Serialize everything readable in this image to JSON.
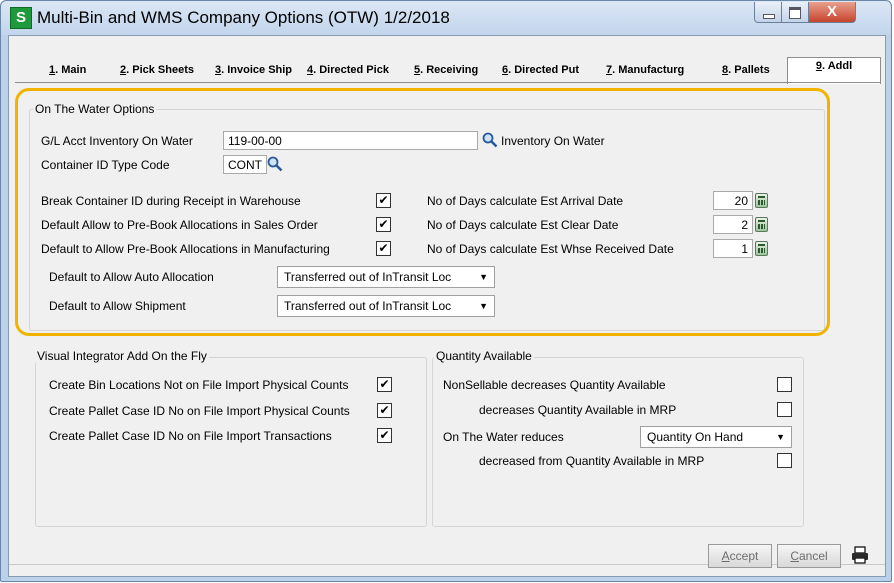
{
  "window": {
    "app_icon": "S",
    "title": "Multi-Bin and WMS Company Options (OTW) 1/2/2018",
    "close_glyph": "X"
  },
  "tabs": [
    {
      "key": "1",
      "label": ". Main"
    },
    {
      "key": "2",
      "label": ". Pick Sheets"
    },
    {
      "key": "3",
      "label": ". Invoice Ship"
    },
    {
      "key": "4",
      "label": ". Directed Pick"
    },
    {
      "key": "5",
      "label": ". Receiving"
    },
    {
      "key": "6",
      "label": ". Directed Put"
    },
    {
      "key": "7",
      "label": ". Manufacturg"
    },
    {
      "key": "8",
      "label": ". Pallets"
    },
    {
      "key": "9",
      "label": ". Addl"
    }
  ],
  "on_water": {
    "title": "On The Water Options",
    "gl_label": "G/L Acct Inventory On Water",
    "gl_value": "119-00-00",
    "gl_desc": "Inventory On Water",
    "container_label": "Container ID Type Code",
    "container_value": "CONT",
    "break_label": "Break Container ID during Receipt in Warehouse",
    "prebook_so_label": "Default Allow to Pre-Book Allocations in Sales Order",
    "prebook_mfg_label": "Default to Allow Pre-Book Allocations in Manufacturing",
    "check_glyph": "✔",
    "arrival_label": "No of Days calculate Est Arrival Date",
    "arrival_value": "20",
    "clear_label": "No of Days calculate Est Clear Date",
    "clear_value": "2",
    "whse_label": "No of Days calculate Est Whse Received Date",
    "whse_value": "1",
    "auto_alloc_label": "Default to Allow Auto Allocation",
    "auto_alloc_value": "Transferred out of InTransit Loc",
    "shipment_label": "Default to Allow Shipment",
    "shipment_value": "Transferred out of InTransit Loc"
  },
  "vi": {
    "title": "Visual Integrator Add On the Fly",
    "bin_label": "Create Bin Locations Not on File Import Physical Counts",
    "pallet_pc_label": "Create Pallet Case ID No on File Import Physical Counts",
    "pallet_tx_label": "Create Pallet Case ID No on File Import Transactions"
  },
  "qty": {
    "title": "Quantity Available",
    "nonsell_label": "NonSellable decreases Quantity Available",
    "nonsell_mrp_label": "decreases Quantity Available in MRP",
    "otw_label": "On The Water reduces",
    "otw_value": "Quantity On Hand",
    "otw_mrp_label": "decreased from Quantity Available in MRP"
  },
  "footer": {
    "accept_key": "A",
    "accept_rest": "ccept",
    "cancel_key": "C",
    "cancel_rest": "ancel"
  }
}
